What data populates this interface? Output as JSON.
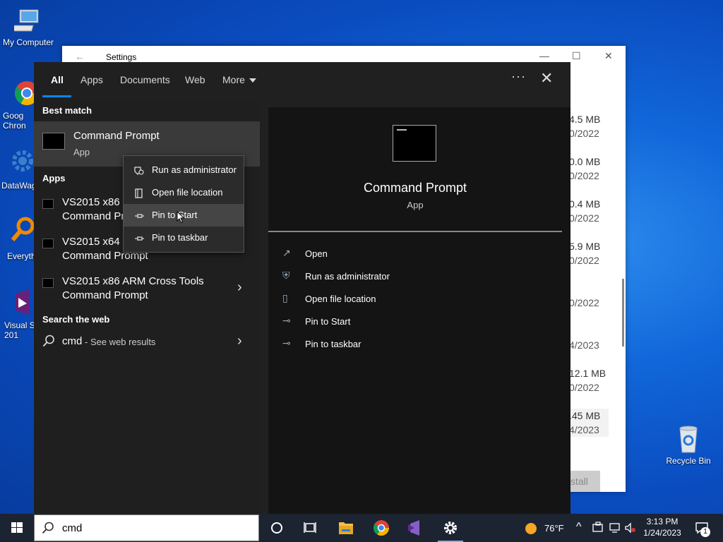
{
  "desktop": {
    "icons": [
      {
        "label": "My Computer"
      },
      {
        "label": "Goog\nChron"
      },
      {
        "label": "DataWag"
      },
      {
        "label": "Everyth"
      },
      {
        "label": "Visual St\n201"
      },
      {
        "label": "Recycle Bin"
      }
    ]
  },
  "settings_window": {
    "title": "Settings",
    "rows": [
      {
        "size": "4.5 MB",
        "date": "0/2022"
      },
      {
        "size": "0.0 MB",
        "date": "0/2022"
      },
      {
        "size": "0.4 MB",
        "date": "0/2022"
      },
      {
        "size": "5.9 MB",
        "date": "0/2022"
      },
      {
        "size": "",
        "date": "0/2022"
      },
      {
        "size": "",
        "date": "4/2023"
      },
      {
        "size": "12.1 MB",
        "date": "0/2022"
      },
      {
        "size": ".45 MB",
        "date": "4/2023"
      }
    ],
    "uninstall_label": "stall"
  },
  "search_panel": {
    "tabs": [
      "All",
      "Apps",
      "Documents",
      "Web",
      "More"
    ],
    "best_match": {
      "heading": "Best match",
      "name": "Command Prompt",
      "kind": "App"
    },
    "apps": {
      "heading": "Apps",
      "items": [
        {
          "line1": "VS2015 x86 N",
          "line2": "Command Pro"
        },
        {
          "line1": "VS2015 x64 N",
          "line2": "Command Prompt"
        },
        {
          "line1": "VS2015 x86 ARM Cross Tools",
          "line2": "Command Prompt"
        }
      ]
    },
    "web": {
      "heading": "Search the web",
      "query": "cmd",
      "hint": " - See web results"
    },
    "preview": {
      "name": "Command Prompt",
      "kind": "App",
      "actions": [
        "Open",
        "Run as administrator",
        "Open file location",
        "Pin to Start",
        "Pin to taskbar"
      ]
    },
    "context_menu": [
      "Run as administrator",
      "Open file location",
      "Pin to Start",
      "Pin to taskbar"
    ]
  },
  "taskbar": {
    "search_query": "cmd",
    "weather": "76°F",
    "time": "3:13 PM",
    "date": "1/24/2023",
    "notifications": "1"
  },
  "colors": {
    "accent": "#0a84ff",
    "panel_bg": "#202020",
    "taskbar_bg": "#1c2331"
  }
}
